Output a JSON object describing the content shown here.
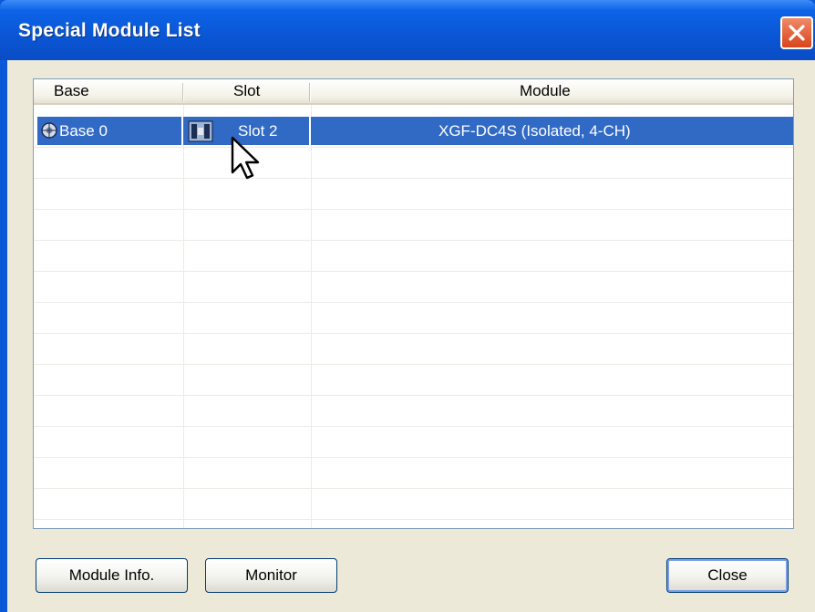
{
  "window": {
    "title": "Special Module List"
  },
  "list": {
    "columns": [
      "Base",
      "Slot",
      "Module"
    ],
    "rows": [
      {
        "base": "Base 0",
        "slot": "Slot 2",
        "module": "XGF-DC4S (Isolated, 4-CH)",
        "selected": true
      }
    ],
    "empty_rows": 12
  },
  "buttons": {
    "module_info": "Module Info.",
    "monitor": "Monitor",
    "close": "Close"
  },
  "icons": {
    "base": "base-icon",
    "slot": "slot-module-icon",
    "close": "close-icon",
    "cursor": "mouse-pointer-icon"
  },
  "colors": {
    "titlebar": "#0a56d6",
    "selection": "#316ac5",
    "client_bg": "#ece9d8",
    "close_button": "#d8441d"
  }
}
